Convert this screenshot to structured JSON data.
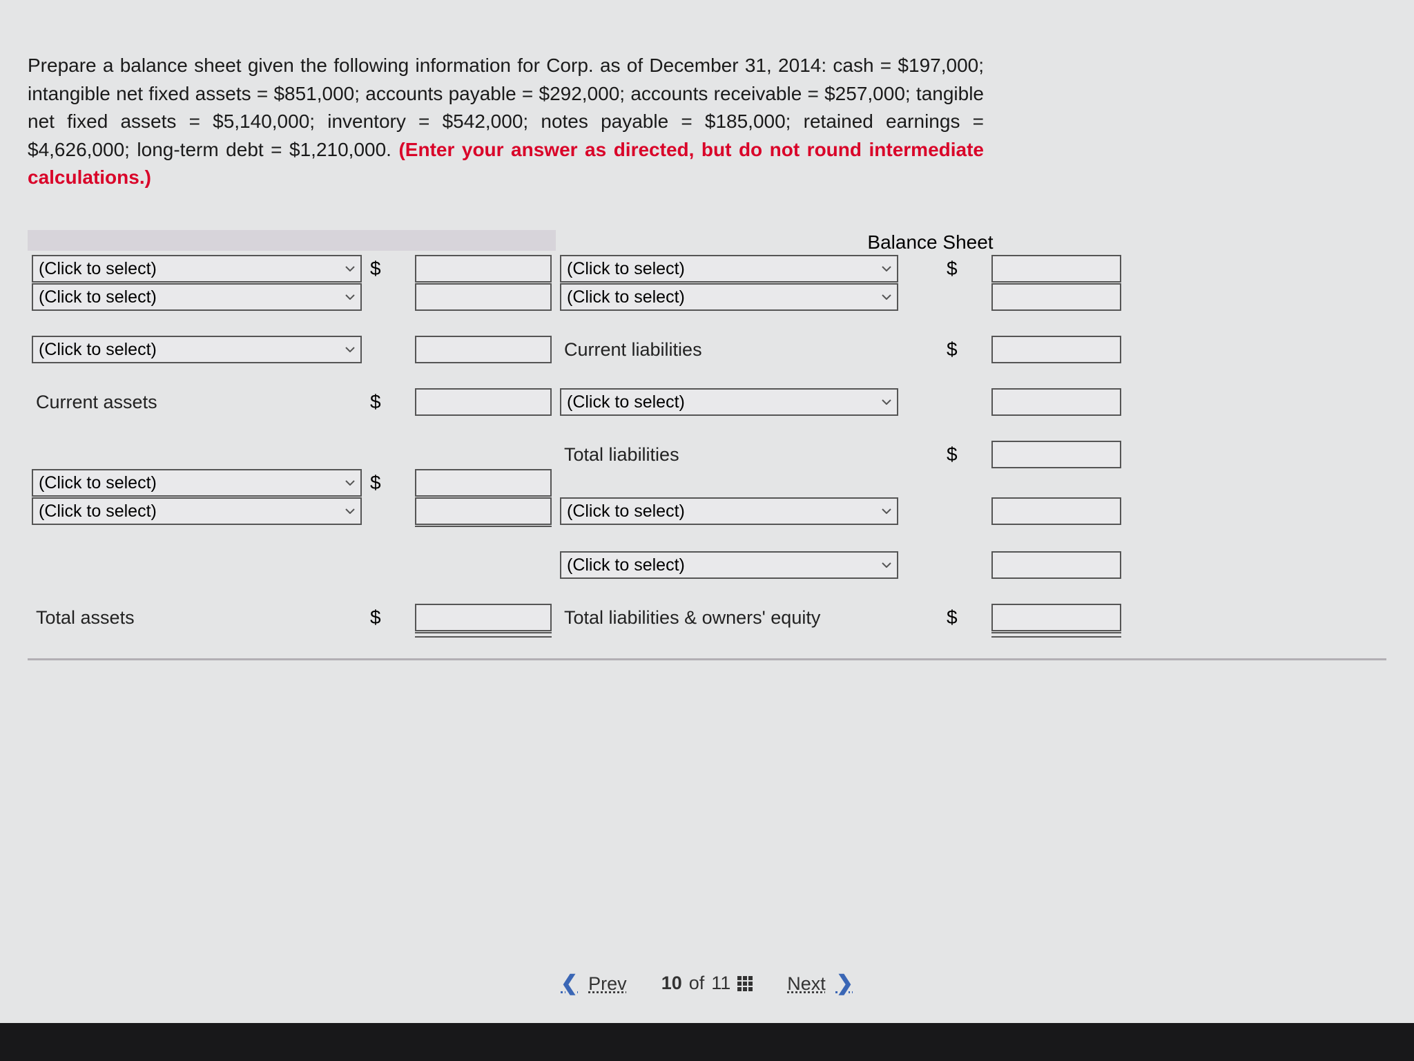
{
  "prompt": {
    "text_part1": "Prepare a balance sheet given the following information for Corp. as of December 31, 2014: cash = $197,000; intangible net fixed assets = $851,000; accounts payable = $292,000; accounts receivable = $257,000; tangible net fixed assets = $5,140,000; inventory = $542,000; notes payable = $185,000; retained earnings = $4,626,000; long-term debt = $1,210,000. ",
    "text_part2": "(Enter your answer as directed, but do not round intermediate calculations.)"
  },
  "sheet": {
    "title": "Balance Sheet",
    "placeholder": "(Click to select)",
    "dollar": "$",
    "labels": {
      "current_assets": "Current assets",
      "current_liabilities": "Current liabilities",
      "total_liabilities": "Total liabilities",
      "total_assets": "Total assets",
      "total_liab_equity": "Total liabilities & owners' equity"
    }
  },
  "footer": {
    "prev": "Prev",
    "next": "Next",
    "current": "10",
    "of": "of",
    "total": "11"
  }
}
